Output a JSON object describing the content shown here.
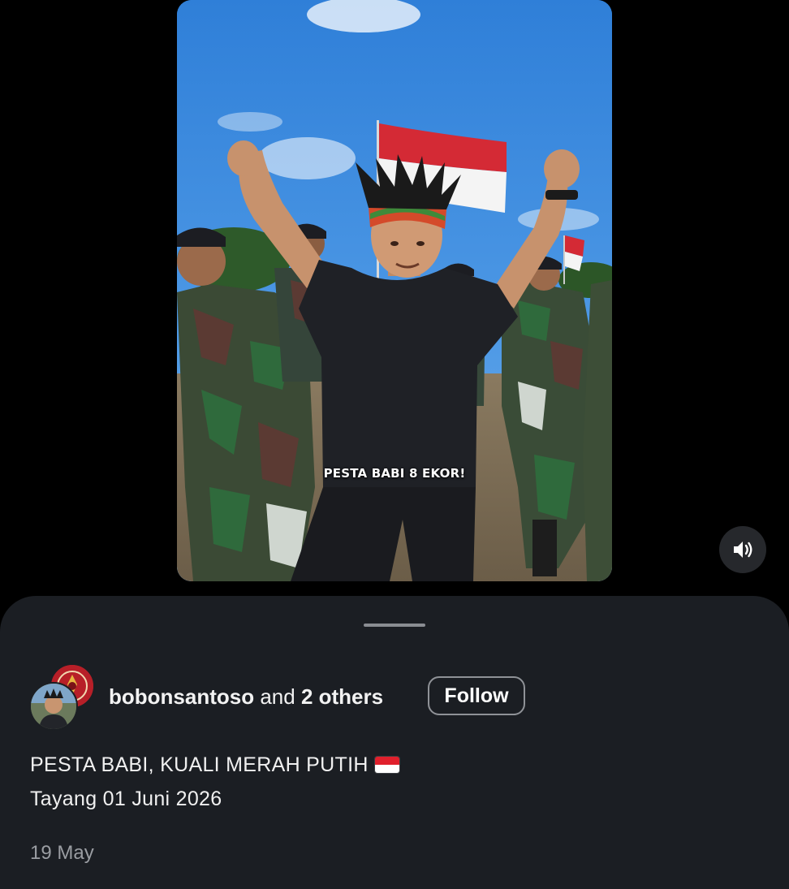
{
  "video": {
    "overlay_caption": "PESTA BABI 8 EKOR!",
    "muted": false
  },
  "controls": {
    "mute_icon": "speaker-on-icon"
  },
  "author": {
    "username": "bobonsantoso",
    "and_text": "and",
    "others_text": "2 others",
    "follow_label": "Follow"
  },
  "post": {
    "caption_line1": "PESTA BABI, KUALI MERAH PUTIH",
    "caption_emoji": "indonesia-flag-icon",
    "caption_line2": "Tayang 01 Juni 2026",
    "date": "19 May"
  },
  "colors": {
    "background": "#000000",
    "sheet": "#1b1e23",
    "text_primary": "#f2f2f2",
    "text_secondary": "#9a9da2",
    "button_border": "#8f9297",
    "flag_red": "#e0202c",
    "flag_white": "#ffffff"
  }
}
